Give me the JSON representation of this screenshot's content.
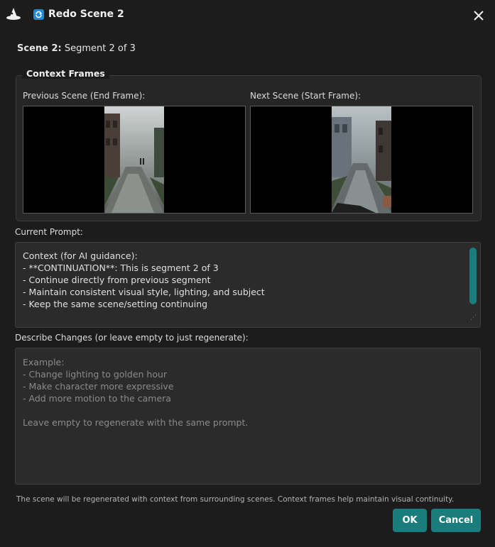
{
  "window": {
    "title": "Redo Scene 2",
    "app_icon": "wizard-hat-icon",
    "title_icon": "redo-icon",
    "close_icon": "close-icon"
  },
  "scene": {
    "label": "Scene 2:",
    "segment": "Segment 2 of 3"
  },
  "context_frames": {
    "title": "Context Frames",
    "previous_label": "Previous Scene (End Frame):",
    "next_label": "Next Scene (Start Frame):"
  },
  "current_prompt": {
    "label": "Current Prompt:",
    "text": "Context (for AI guidance):\n- **CONTINUATION**: This is segment 2 of 3\n- Continue directly from previous segment\n- Maintain consistent visual style, lighting, and subject\n- Keep the same scene/setting continuing"
  },
  "changes": {
    "label": "Describe Changes (or leave empty to just regenerate):",
    "placeholder": "Example:\n- Change lighting to golden hour\n- Make character more expressive\n- Add more motion to the camera\n\nLeave empty to regenerate with the same prompt."
  },
  "footer": {
    "note": "The scene will be regenerated with context from surrounding scenes. Context frames help maintain visual continuity."
  },
  "buttons": {
    "ok": "OK",
    "cancel": "Cancel"
  },
  "colors": {
    "accent": "#1b7c7e",
    "background": "#1c1c1c",
    "title_icon": "#1f8ad2"
  }
}
